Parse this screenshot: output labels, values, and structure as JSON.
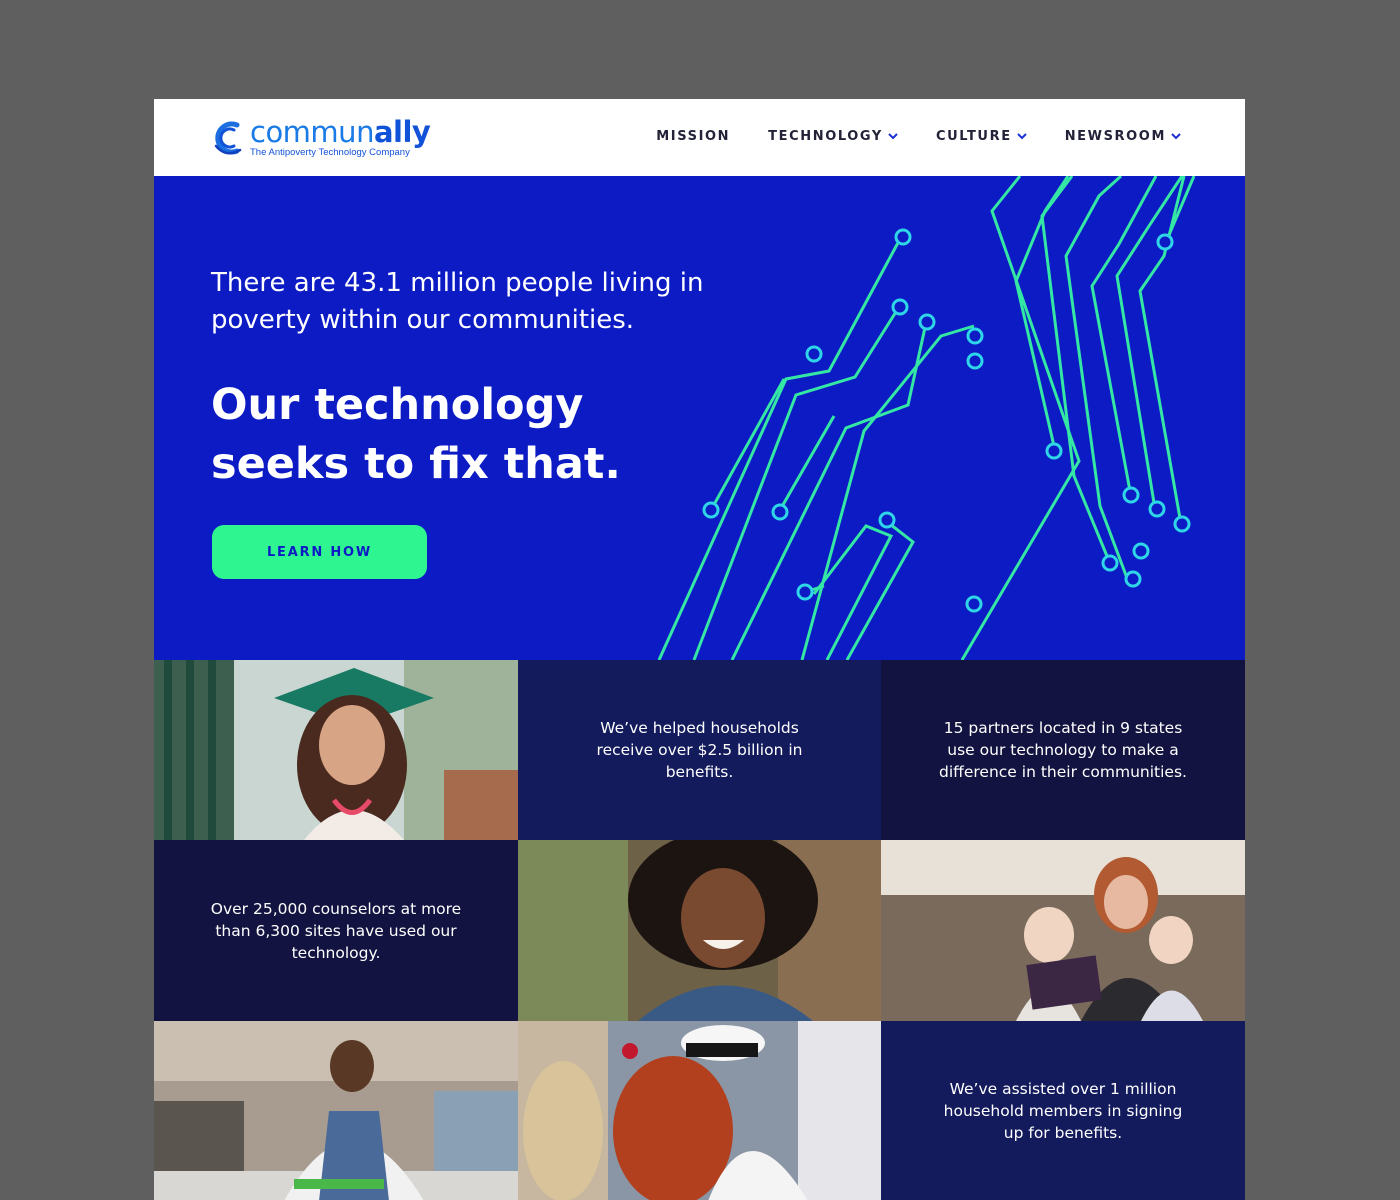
{
  "brand": {
    "name_part1": "commun",
    "name_part2": "ally",
    "tagline": "The Antipoverty Technology Company"
  },
  "nav": {
    "items": [
      {
        "label": "MISSION",
        "has_dropdown": false
      },
      {
        "label": "TECHNOLOGY",
        "has_dropdown": true
      },
      {
        "label": "CULTURE",
        "has_dropdown": true
      },
      {
        "label": "NEWSROOM",
        "has_dropdown": true
      }
    ]
  },
  "hero": {
    "lead": "There are 43.1 million people living in poverty within our communities.",
    "title": "Our technology seeks to fix that.",
    "cta": "LEARN HOW"
  },
  "stats": {
    "benefits": "We’ve helped households receive over $2.5 billion in benefits.",
    "partners": "15 partners located in 9 states use our technology to make a difference in their communities.",
    "counselors": "Over 25,000 counselors at more than 6,300 sites have used our technology.",
    "households": "We’ve assisted over 1 million household members in signing up for benefits."
  },
  "colors": {
    "hero_bg": "#0c1bc4",
    "accent_green": "#2ef58f",
    "circuit_teal": "#35e7a5",
    "circuit_node": "#2fd6e8",
    "stat_navy": "#131b5c",
    "stat_dark": "#121340",
    "logo_blue": "#1b7be6"
  }
}
